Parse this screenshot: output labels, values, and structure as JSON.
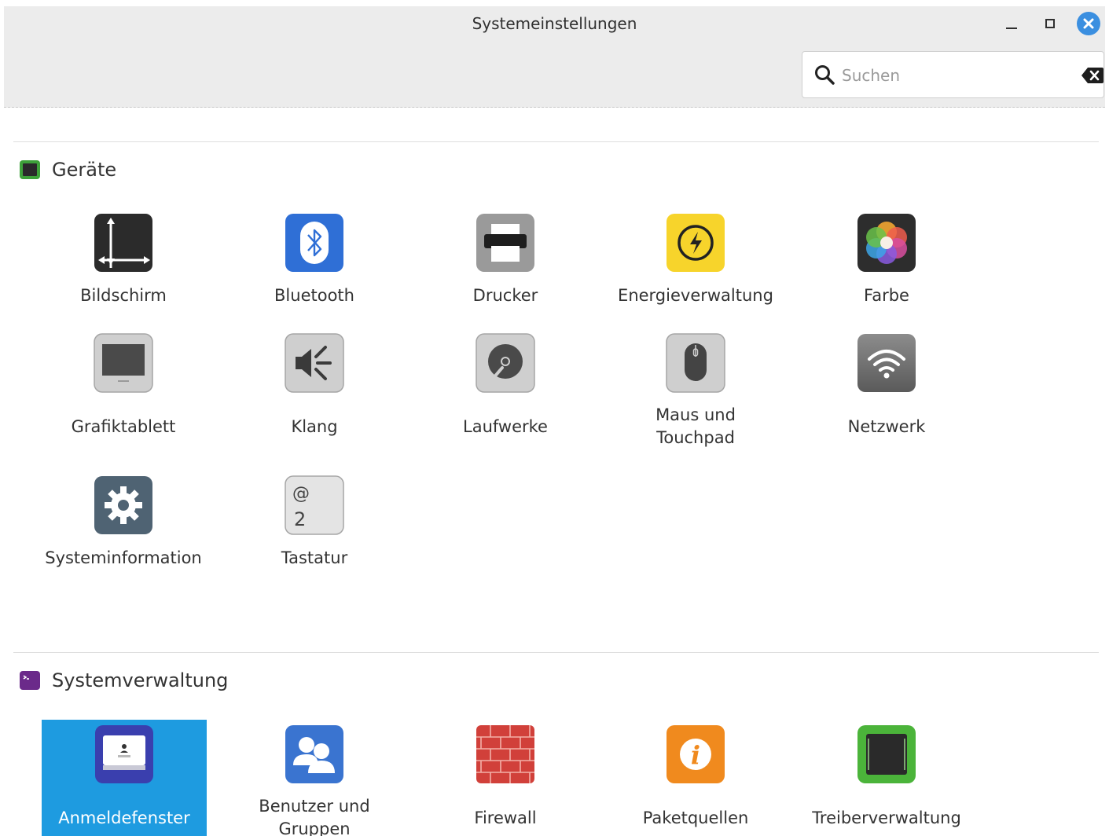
{
  "window": {
    "title": "Systemeinstellungen",
    "accent_color": "#1e9be0"
  },
  "search": {
    "placeholder": "Suchen",
    "value": ""
  },
  "sections": [
    {
      "title": "Geräte",
      "items": [
        {
          "label": "Bildschirm",
          "icon": "display-icon"
        },
        {
          "label": "Bluetooth",
          "icon": "bluetooth-icon"
        },
        {
          "label": "Drucker",
          "icon": "printer-icon"
        },
        {
          "label": "Energieverwaltung",
          "icon": "power-icon"
        },
        {
          "label": "Farbe",
          "icon": "color-icon"
        },
        {
          "label": "Grafiktablett",
          "icon": "tablet-icon"
        },
        {
          "label": "Klang",
          "icon": "sound-icon"
        },
        {
          "label": "Laufwerke",
          "icon": "disk-icon"
        },
        {
          "label": "Maus und Touchpad",
          "icon": "mouse-icon"
        },
        {
          "label": "Netzwerk",
          "icon": "network-icon"
        },
        {
          "label": "Systeminformation",
          "icon": "system-info-icon"
        },
        {
          "label": "Tastatur",
          "icon": "keyboard-icon"
        }
      ]
    },
    {
      "title": "Systemverwaltung",
      "items": [
        {
          "label": "Anmeldefenster",
          "icon": "login-window-icon",
          "selected": true
        },
        {
          "label": "Benutzer und Gruppen",
          "icon": "users-icon"
        },
        {
          "label": "Firewall",
          "icon": "firewall-icon"
        },
        {
          "label": "Paketquellen",
          "icon": "software-sources-icon"
        },
        {
          "label": "Treiberverwaltung",
          "icon": "driver-icon"
        }
      ]
    }
  ]
}
